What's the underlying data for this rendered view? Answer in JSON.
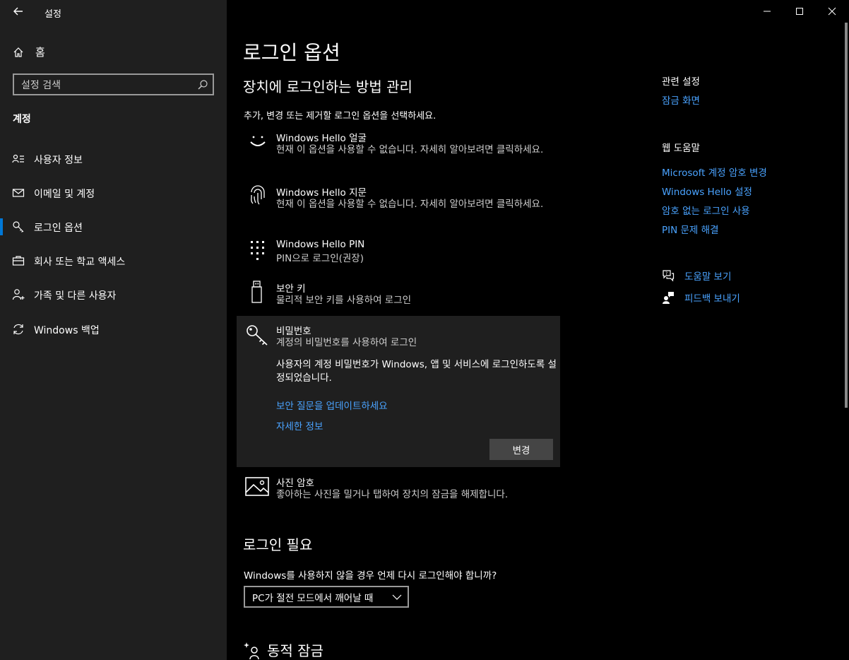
{
  "window": {
    "title": "설정"
  },
  "sidebar": {
    "home_label": "홈",
    "search_placeholder": "설정 검색",
    "section_title": "계정",
    "items": [
      {
        "label": "사용자 정보",
        "icon": "user-info-icon"
      },
      {
        "label": "이메일 및 계정",
        "icon": "mail-icon"
      },
      {
        "label": "로그인 옵션",
        "icon": "key-icon",
        "selected": true
      },
      {
        "label": "회사 또는 학교 액세스",
        "icon": "briefcase-icon"
      },
      {
        "label": "가족 및 다른 사용자",
        "icon": "person-add-icon"
      },
      {
        "label": "Windows 백업",
        "icon": "sync-icon"
      }
    ]
  },
  "main": {
    "title": "로그인 옵션",
    "subtitle": "장치에 로그인하는 방법 관리",
    "description": "추가, 변경 또는 제거할 로그인 옵션을 선택하세요.",
    "options": [
      {
        "title": "Windows Hello 얼굴",
        "desc": "현재 이 옵션을 사용할 수 없습니다. 자세히 알아보려면 클릭하세요.",
        "icon": "face-icon"
      },
      {
        "title": "Windows Hello 지문",
        "desc": "현재 이 옵션을 사용할 수 없습니다. 자세히 알아보려면 클릭하세요.",
        "icon": "fingerprint-icon"
      },
      {
        "title": "Windows Hello PIN",
        "desc": "PIN으로 로그인(권장)",
        "icon": "pin-keypad-icon"
      },
      {
        "title": "보안 키",
        "desc": "물리적 보안 키를 사용하여 로그인",
        "icon": "usb-key-icon"
      },
      {
        "title": "비밀번호",
        "desc": "계정의 비밀번호를 사용하여 로그인",
        "icon": "password-key-icon"
      },
      {
        "title": "사진 암호",
        "desc": "좋아하는 사진을 밀거나 탭하여 장치의 잠금을 해제합니다.",
        "icon": "picture-icon"
      }
    ],
    "password_expanded": {
      "text": "사용자의 계정 비밀번호가 Windows, 앱 및 서비스에 로그인하도록 설정되었습니다.",
      "link1": "보안 질문을 업데이트하세요",
      "link2": "자세한 정보",
      "button": "변경"
    },
    "require_signin": {
      "title": "로그인 필요",
      "question": "Windows를 사용하지 않을 경우 언제 다시 로그인해야 합니까?",
      "selected": "PC가 절전 모드에서 깨어날 때"
    },
    "dynamic_lock": {
      "title": "동적 잠금"
    }
  },
  "related": {
    "title": "관련 설정",
    "links": [
      "잠금 화면"
    ],
    "web_help_title": "웹 도움말",
    "web_links": [
      "Microsoft 계정 암호 변경",
      "Windows Hello 설정",
      "암호 없는 로그인 사용",
      "PIN 문제 해결"
    ],
    "help": {
      "get_help": "도움말 보기",
      "feedback": "피드백 보내기"
    }
  }
}
